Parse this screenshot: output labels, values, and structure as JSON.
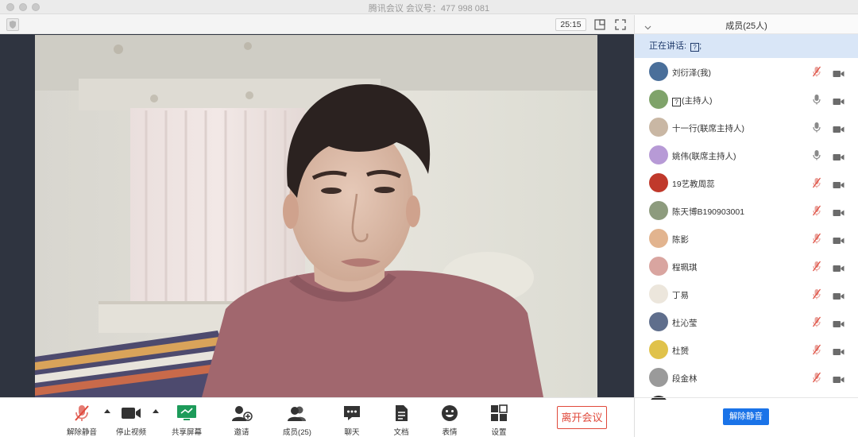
{
  "window": {
    "title": "腾讯会议 会议号：477 998 081"
  },
  "topbar": {
    "timer": "25:15"
  },
  "toolbar": {
    "unmute": "解除静音",
    "stop_video": "停止视频",
    "share_screen": "共享屏幕",
    "invite": "邀请",
    "members": "成员(25)",
    "chat": "聊天",
    "docs": "文档",
    "reactions": "表情",
    "settings": "设置",
    "leave": "离开会议"
  },
  "panel": {
    "title": "成员(25人)",
    "speaking_label": "正在讲话: ",
    "speaking_glyph": "?",
    "speaking_suffix": ";",
    "unmute_all": "解除静音",
    "members": [
      {
        "name": "刘衍泽(我)",
        "avatar_color": "#4a6f9a",
        "mic_muted": true
      },
      {
        "name": "(主持人)",
        "prefix_glyph": "?",
        "avatar_color": "#7fa36a",
        "mic_muted": false
      },
      {
        "name": "十一行(联席主持人)",
        "avatar_color": "#c9b7a4",
        "mic_muted": false
      },
      {
        "name": "姚伟(联席主持人)",
        "avatar_color": "#b79ad6",
        "mic_muted": false
      },
      {
        "name": "19艺教周蕊",
        "avatar_color": "#c0392b",
        "mic_muted": true
      },
      {
        "name": "陈天博B190903001",
        "avatar_color": "#8d9b7d",
        "mic_muted": true
      },
      {
        "name": "陈影",
        "avatar_color": "#e2b48f",
        "mic_muted": true
      },
      {
        "name": "程珮琪",
        "avatar_color": "#d9a5a0",
        "mic_muted": true
      },
      {
        "name": "丁易",
        "avatar_color": "#ece6dc",
        "mic_muted": true
      },
      {
        "name": "杜沁莹",
        "avatar_color": "#5f6e8c",
        "mic_muted": true
      },
      {
        "name": "杜赟",
        "avatar_color": "#e0c24a",
        "mic_muted": true
      },
      {
        "name": "段金林",
        "avatar_color": "#9a9a9a",
        "mic_muted": true
      },
      {
        "name": "",
        "avatar_color": "#2c2c2c",
        "mic_muted": true
      }
    ]
  },
  "colors": {
    "accent": "#1a73e8",
    "danger": "#e0493b",
    "speaking_bg": "#d9e6f7",
    "muted_mic": "#e57b73",
    "icon_gray": "#6b6b6b"
  }
}
